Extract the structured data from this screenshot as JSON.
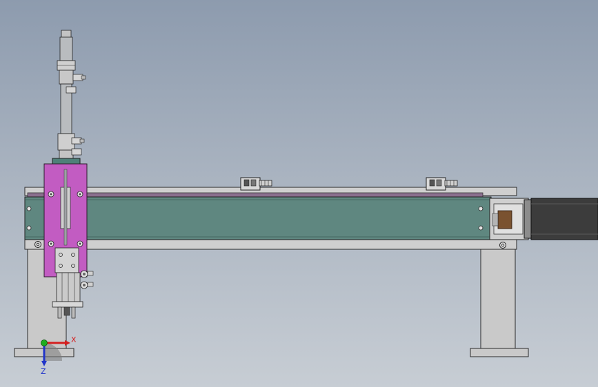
{
  "view": {
    "background_top": "#8d9bae",
    "background_bottom": "#c7cdd4"
  },
  "colors": {
    "frame_gray": "#c9c9c9",
    "linear_module_teal": "#5f8780",
    "carriage_plate_magenta": "#c25cc2",
    "motor_dark": "#3c3c3c",
    "coupling_brown": "#7a5230",
    "cylinder_silver": "#b9bcbf",
    "axis_x_color": "#d41f1f",
    "axis_y_color": "#1fae1f",
    "axis_z_color": "#2135c9"
  },
  "triad": {
    "x_label": "X",
    "z_label": "Z"
  }
}
